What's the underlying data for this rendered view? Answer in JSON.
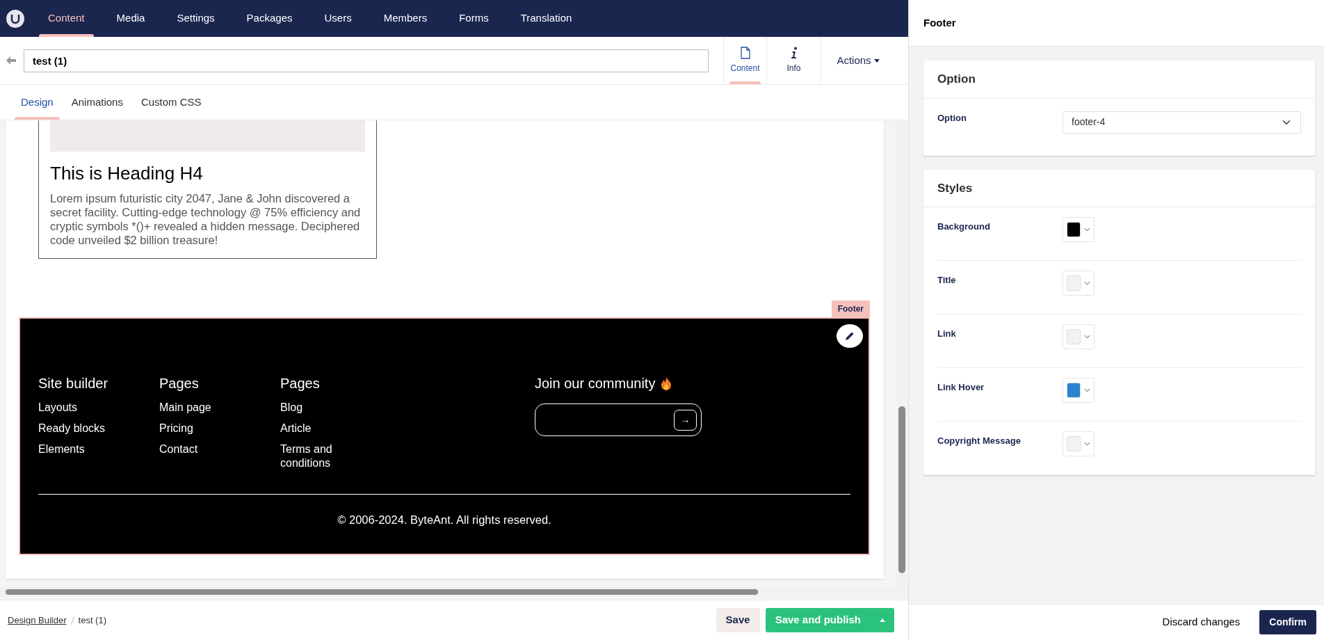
{
  "nav": {
    "items": [
      {
        "label": "Content",
        "selected": true
      },
      {
        "label": "Media",
        "selected": false
      },
      {
        "label": "Settings",
        "selected": false
      },
      {
        "label": "Packages",
        "selected": false
      },
      {
        "label": "Users",
        "selected": false
      },
      {
        "label": "Members",
        "selected": false
      },
      {
        "label": "Forms",
        "selected": false
      },
      {
        "label": "Translation",
        "selected": false
      }
    ]
  },
  "header": {
    "name_value": "test (1)",
    "apps": [
      {
        "label": "Content",
        "kind": "document",
        "selected": true
      },
      {
        "label": "Info",
        "kind": "info",
        "selected": false
      }
    ],
    "actions": "Actions"
  },
  "tabs": [
    {
      "label": "Design",
      "selected": true
    },
    {
      "label": "Animations",
      "selected": false
    },
    {
      "label": "Custom CSS",
      "selected": false
    }
  ],
  "canvas": {
    "card": {
      "heading": "This is Heading H4",
      "text": "Lorem ipsum futuristic city 2047, Jane & John discovered a secret facility. Cutting-edge technology @ 75% efficiency and cryptic symbols *()+ revealed a hidden message. Deciphered code unveiled $2 billion treasure!"
    },
    "footer_block": {
      "label": "Footer",
      "columns": [
        {
          "title": "Site builder",
          "links": [
            "Layouts",
            "Ready blocks",
            "Elements"
          ]
        },
        {
          "title": "Pages",
          "links": [
            "Main page",
            "Pricing",
            "Contact"
          ]
        },
        {
          "title": "Pages",
          "links": [
            "Blog",
            "Article",
            "Terms and conditions"
          ]
        }
      ],
      "community": {
        "title": "Join our community",
        "button": "→"
      },
      "copyright": "© 2006-2024. ByteAnt. All rights reserved."
    }
  },
  "breadcrumb": [
    {
      "label": "Design Builder",
      "kind": "link"
    },
    {
      "label": "test (1)",
      "kind": "current"
    }
  ],
  "bottom_buttons": {
    "save": "Save",
    "publish": "Save and publish"
  },
  "panel": {
    "title": "Footer",
    "sections": [
      {
        "title": "Option",
        "fields": [
          {
            "kind": "select",
            "label": "Option",
            "value": "footer-4"
          }
        ]
      },
      {
        "title": "Styles",
        "fields": [
          {
            "kind": "color",
            "label": "Background",
            "color": "#000000"
          },
          {
            "kind": "color",
            "label": "Title",
            "color": "#f2f2f2"
          },
          {
            "kind": "color",
            "label": "Link",
            "color": "#f2f2f2"
          },
          {
            "kind": "color",
            "label": "Link Hover",
            "color": "#2a83d0"
          },
          {
            "kind": "color",
            "label": "Copyright Message",
            "color": "#f2f2f2"
          }
        ]
      }
    ],
    "discard": "Discard changes",
    "confirm": "Confirm"
  }
}
